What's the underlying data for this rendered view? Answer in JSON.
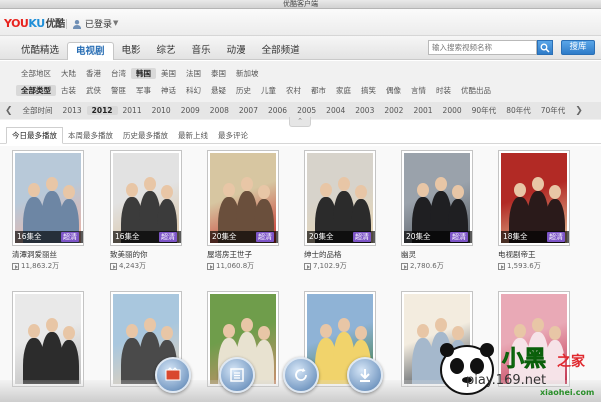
{
  "window": {
    "title": "优酷客户端"
  },
  "topbar": {
    "logo_main": "YOU",
    "logo_blue": "KU",
    "logo_cn": "优酷",
    "login_label": "已登录"
  },
  "nav": {
    "tabs": [
      {
        "label": "优酷精选"
      },
      {
        "label": "电视剧",
        "active": true
      },
      {
        "label": "电影"
      },
      {
        "label": "综艺"
      },
      {
        "label": "音乐"
      },
      {
        "label": "动漫"
      },
      {
        "label": "全部频道"
      }
    ],
    "search_placeholder": "输入搜索视频名称",
    "library_label": "搜库"
  },
  "filters": {
    "regions": [
      "全部地区",
      "大陆",
      "香港",
      "台湾",
      "韩国",
      "美国",
      "法国",
      "泰国",
      "新加坡"
    ],
    "region_selected": "韩国",
    "genres": [
      "全部类型",
      "古装",
      "武侠",
      "警匪",
      "军事",
      "神话",
      "科幻",
      "悬疑",
      "历史",
      "儿童",
      "农村",
      "都市",
      "家庭",
      "搞笑",
      "偶像",
      "言情",
      "时装",
      "优酷出品"
    ],
    "genre_selected": "全部类型",
    "years": [
      "全部时间",
      "2013",
      "2012",
      "2011",
      "2010",
      "2009",
      "2008",
      "2007",
      "2006",
      "2005",
      "2004",
      "2003",
      "2002",
      "2001",
      "2000",
      "90年代",
      "80年代",
      "70年代"
    ],
    "year_selected": "2012"
  },
  "sort_tabs": [
    {
      "label": "今日最多播放",
      "active": true
    },
    {
      "label": "本周最多播放"
    },
    {
      "label": "历史最多播放"
    },
    {
      "label": "最新上线"
    },
    {
      "label": "最多评论"
    }
  ],
  "hd_badge": "超清",
  "shows": [
    {
      "title": "清潭洞爱丽丝",
      "episodes": "16集全",
      "plays": "11,863.2万",
      "colors": [
        "#b8c9d9",
        "#6d86a4",
        "#f0b1a0"
      ]
    },
    {
      "title": "致美丽的你",
      "episodes": "16集全",
      "plays": "4,243万",
      "colors": [
        "#e2e2e2",
        "#3b3b3b",
        "#d9c2a0"
      ]
    },
    {
      "title": "屋塔房王世子",
      "episodes": "20集全",
      "plays": "11,060.8万",
      "colors": [
        "#d7c6a1",
        "#6a4f3c",
        "#c9302c"
      ]
    },
    {
      "title": "绅士的品格",
      "episodes": "20集全",
      "plays": "7,102.9万",
      "colors": [
        "#d7d3cb",
        "#2b2b2b",
        "#e8d5b0"
      ]
    },
    {
      "title": "幽灵",
      "episodes": "20集全",
      "plays": "2,780.6万",
      "colors": [
        "#9aa2ab",
        "#1f1f22",
        "#555b63"
      ]
    },
    {
      "title": "电视剧帝王",
      "episodes": "18集全",
      "plays": "1,593.6万",
      "colors": [
        "#b22a25",
        "#2a1a1a",
        "#e6c49a"
      ]
    },
    {
      "title": "",
      "episodes": "",
      "plays": "",
      "colors": [
        "#e9e9e9",
        "#2c2c2c",
        "#bcbcbc"
      ]
    },
    {
      "title": "",
      "episodes": "",
      "plays": "",
      "colors": [
        "#a9c7de",
        "#4a4a4a",
        "#e6d2b8"
      ]
    },
    {
      "title": "",
      "episodes": "",
      "plays": "",
      "colors": [
        "#6f9d4b",
        "#e8e2d0",
        "#c98f6d"
      ]
    },
    {
      "title": "",
      "episodes": "",
      "plays": "",
      "colors": [
        "#8fb3d6",
        "#f1d36b",
        "#3d7a3d"
      ]
    },
    {
      "title": "",
      "episodes": "",
      "plays": "",
      "colors": [
        "#f3ecdf",
        "#a5b8cc",
        "#39424d"
      ]
    },
    {
      "title": "",
      "episodes": "",
      "plays": "",
      "colors": [
        "#e9a9b6",
        "#f6e3e8",
        "#c2334f"
      ]
    }
  ],
  "dock": [
    {
      "name": "film-icon"
    },
    {
      "name": "list-icon"
    },
    {
      "name": "refresh-icon"
    },
    {
      "name": "download-icon"
    }
  ],
  "watermark": {
    "domain": "piay.169.net",
    "site": "xiaohei.com"
  }
}
